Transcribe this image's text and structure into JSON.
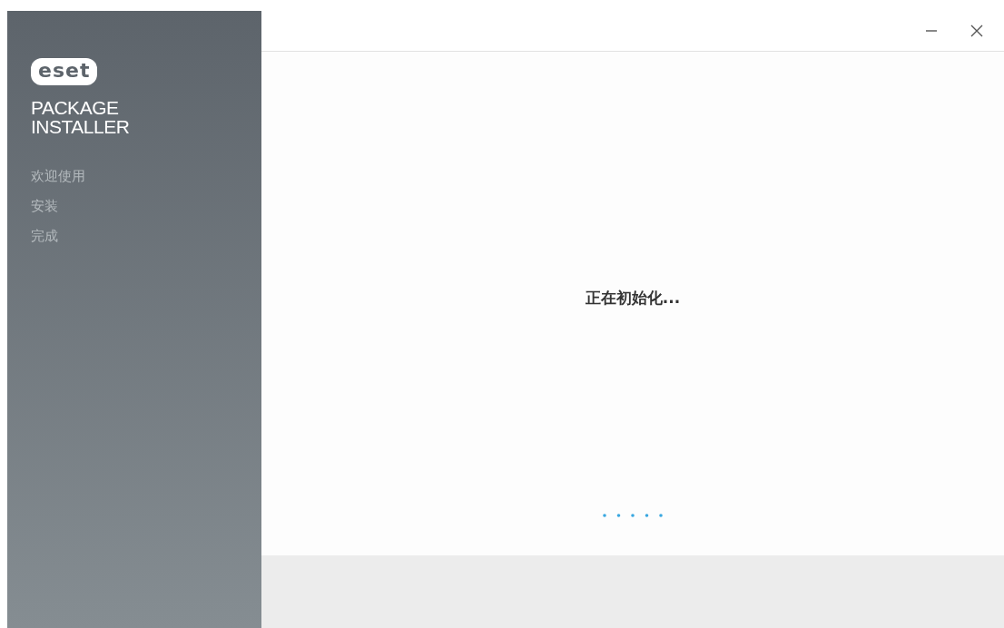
{
  "sidebar": {
    "logo": "eset",
    "product": [
      "PACKAGE",
      "INSTALLER"
    ],
    "steps": [
      {
        "label": "欢迎使用"
      },
      {
        "label": "安装"
      },
      {
        "label": "完成"
      }
    ]
  },
  "main": {
    "status": "正在初始化..."
  }
}
